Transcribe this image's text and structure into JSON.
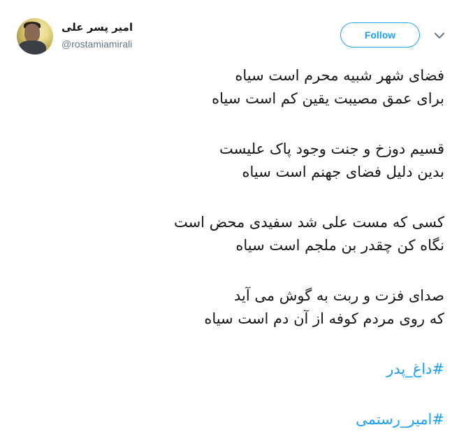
{
  "user": {
    "display_name": "امیر پسر علی",
    "handle": "@rostamiamirali"
  },
  "actions": {
    "follow_label": "Follow",
    "menu_icon": "chevron-down-icon"
  },
  "tweet": {
    "stanzas": [
      [
        "فضای شهر شبیه محرم است سیاه",
        "برای عمق مصیبت یقین کم است سیاه"
      ],
      [
        "قسیم دوزخ و جنت وجود پاک علیست",
        "بدین دلیل فضای جهنم است سیاه"
      ],
      [
        "کسی که مست علی شد سفیدی محض است",
        "نگاه کن چقدر بن ملجم است سیاه"
      ],
      [
        "صدای فزت و ربت به گوش می آید",
        "که روی مردم  کوفه از آن دم است سیاه"
      ]
    ],
    "hashtags": [
      "#داغ_پدر",
      "#امیر_رستمی"
    ]
  },
  "colors": {
    "accent": "#1da1f2",
    "text": "#14171a",
    "secondary": "#657786"
  }
}
